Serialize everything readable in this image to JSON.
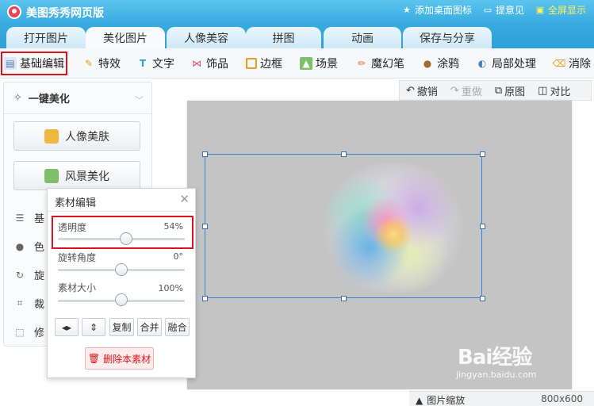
{
  "app": {
    "title": "美图秀秀网页版",
    "links": [
      "添加桌面图标",
      "提意见",
      "全屏显示"
    ]
  },
  "tabs": [
    "打开图片",
    "美化图片",
    "人像美容",
    "拼图",
    "动画",
    "保存与分享"
  ],
  "active_tab": "美化图片",
  "toolbar": [
    "基础编辑",
    "特效",
    "文字",
    "饰品",
    "边框",
    "场景",
    "魔幻笔",
    "涂鸦",
    "局部处理",
    "消除"
  ],
  "left_panel": {
    "header": "一键美化",
    "buttons": [
      "人像美肤",
      "风景美化"
    ],
    "items": [
      "基",
      "色",
      "旋",
      "裁",
      "修"
    ]
  },
  "actions": {
    "undo": "撤销",
    "redo": "重做",
    "original": "原图",
    "compare": "对比"
  },
  "dialog": {
    "title": "素材编辑",
    "sliders": [
      {
        "label": "透明度",
        "value_text": "54%",
        "value": 54,
        "max": 100
      },
      {
        "label": "旋转角度",
        "value_text": "0°",
        "value": 0,
        "min": -180,
        "max": 180
      },
      {
        "label": "素材大小",
        "value_text": "100%",
        "value": 100,
        "min": 0,
        "max": 200
      }
    ],
    "small_buttons": [
      "复制",
      "合并",
      "融合"
    ],
    "delete_label": "删除本素材"
  },
  "status": {
    "zoom_label": "图片缩放",
    "size": "800x600"
  },
  "watermark": {
    "logo": "Bai经验",
    "url": "jingyan.baidu.com"
  },
  "colors": {
    "accent": "#38abe0",
    "highlight": "#d9141e",
    "canvas": "#c4c4c4"
  }
}
